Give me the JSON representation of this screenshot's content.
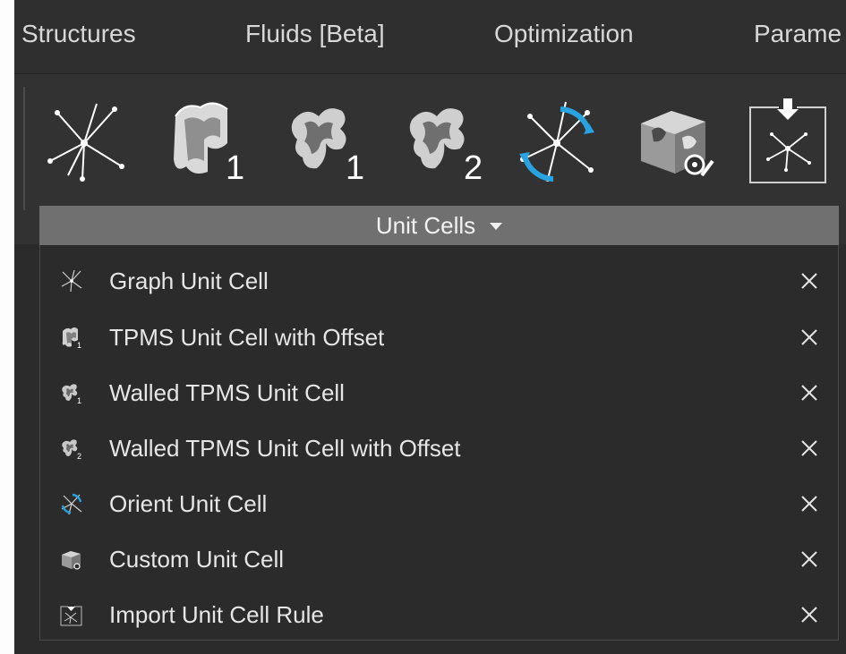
{
  "tabs": [
    {
      "label": "Structures"
    },
    {
      "label": "Fluids [Beta]"
    },
    {
      "label": "Optimization"
    },
    {
      "label": "Parame"
    }
  ],
  "ribbon": {
    "tools": [
      {
        "icon": "graph-unit-cell-icon"
      },
      {
        "icon": "tpms-offset-icon",
        "subscript": "1"
      },
      {
        "icon": "walled-tpms-icon",
        "subscript": "1"
      },
      {
        "icon": "walled-tpms-offset-icon",
        "subscript": "2"
      },
      {
        "icon": "orient-unit-cell-icon"
      },
      {
        "icon": "custom-unit-cell-icon"
      },
      {
        "icon": "import-unit-cell-rule-icon"
      }
    ],
    "group_label": "Unit Cells"
  },
  "menu": {
    "items": [
      {
        "label": "Graph Unit Cell",
        "icon": "graph-unit-cell-icon"
      },
      {
        "label": "TPMS Unit Cell with Offset",
        "icon": "tpms-offset-icon"
      },
      {
        "label": "Walled TPMS Unit Cell",
        "icon": "walled-tpms-icon"
      },
      {
        "label": "Walled TPMS Unit Cell with Offset",
        "icon": "walled-tpms-offset-icon"
      },
      {
        "label": "Orient Unit Cell",
        "icon": "orient-unit-cell-icon"
      },
      {
        "label": "Custom Unit Cell",
        "icon": "custom-unit-cell-icon"
      },
      {
        "label": "Import Unit Cell Rule",
        "icon": "import-unit-cell-rule-icon"
      }
    ]
  },
  "colors": {
    "background": "#2b2b2b",
    "group_header": "#707070",
    "accent_blue": "#29a3e0",
    "text": "#e6e6e6"
  }
}
